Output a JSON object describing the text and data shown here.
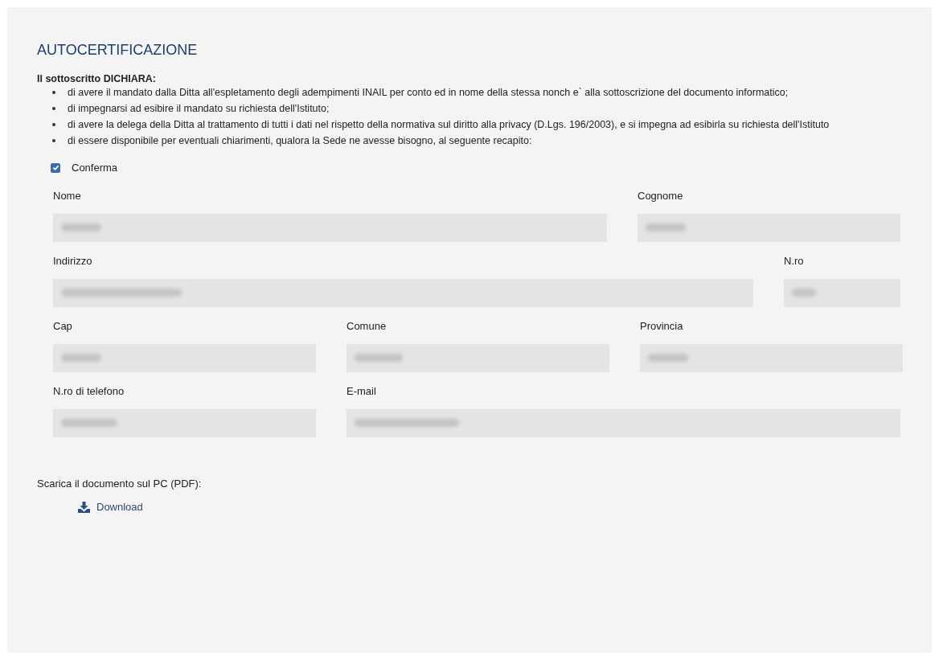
{
  "title": "AUTOCERTIFICAZIONE",
  "declaration": {
    "heading": "Il sottoscritto DICHIARA:",
    "items": [
      "di avere il mandato dalla Ditta all'espletamento degli adempimenti INAIL per conto ed in nome della stessa nonch e` alla sottoscrizione del documento informatico;",
      "di impegnarsi ad esibire il mandato su richiesta dell'Istituto;",
      "di avere la delega della Ditta al trattamento di tutti i dati nel rispetto della normativa sul diritto alla privacy (D.Lgs. 196/2003), e si impegna ad esibirla su richiesta dell'Istituto",
      "di essere disponibile per eventuali chiarimenti, qualora la Sede ne avesse bisogno, al seguente recapito:"
    ]
  },
  "confirm": {
    "label": "Conferma",
    "checked": true
  },
  "form_rows": [
    {
      "fields": [
        {
          "label": "Nome"
        },
        {
          "label": "Cognome"
        }
      ]
    },
    {
      "fields": [
        {
          "label": "Indirizzo"
        },
        {
          "label": "N.ro"
        }
      ]
    },
    {
      "fields": [
        {
          "label": "Cap"
        },
        {
          "label": "Comune"
        },
        {
          "label": "Provincia"
        }
      ]
    },
    {
      "fields": [
        {
          "label": "N.ro di telefono"
        },
        {
          "label": "E-mail"
        }
      ]
    }
  ],
  "download": {
    "caption": "Scarica il documento sul PC (PDF):",
    "link": "Download"
  }
}
